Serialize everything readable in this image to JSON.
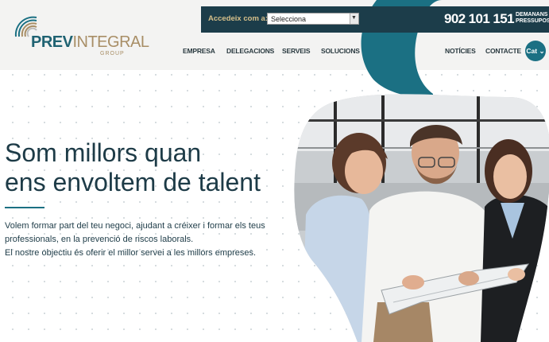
{
  "brand": {
    "name_part1": "PREV",
    "name_part2": "INTEGRAL",
    "subline": "GROUP"
  },
  "topbar": {
    "access_label": "Accedeix com a:",
    "select_value": "Selecciona"
  },
  "contact": {
    "phone": "902 101 151",
    "budget_line1": "DEMANANS",
    "budget_line2": "PRESSUPOST"
  },
  "nav": {
    "items": [
      "EMPRESA",
      "DELEGACIONS",
      "SERVEIS",
      "SOLUCIONS",
      "NOTÍCIES",
      "CONTACTE"
    ],
    "language": "Cat"
  },
  "hero": {
    "title_line1": "Som millors quan",
    "title_line2": "ens envoltem de talent",
    "intro_line1": "Volem formar part del teu negoci, ajudant a créixer i formar els teus",
    "intro_line2": "professionals, en la prevenció de riscos laborals.",
    "intro_line3": "El nostre objectiu és oferir el millor servei a les millors empreses."
  },
  "colors": {
    "primary": "#1b7083",
    "dark": "#1d3b47",
    "gold": "#a88e66"
  }
}
